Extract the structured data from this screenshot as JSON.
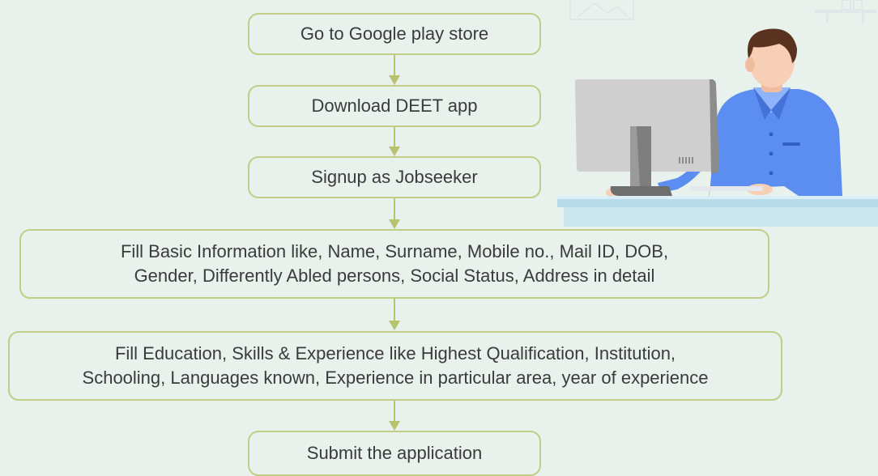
{
  "flowchart": {
    "steps": [
      "Go to Google play store",
      "Download DEET app",
      "Signup as Jobseeker",
      "Fill Basic Information like, Name, Surname, Mobile no., Mail ID, DOB,\nGender, Differently Abled persons, Social Status, Address in detail",
      "Fill Education, Skills & Experience like Highest Qualification, Institution,\nSchooling, Languages known, Experience in particular area, year of experience",
      "Submit the application"
    ]
  },
  "illustration": {
    "icon": "person-at-computer-icon"
  },
  "colors": {
    "background": "#e8f1ec",
    "box_border": "#c2cd86",
    "arrow": "#b6c46e",
    "text": "#3b3b3b",
    "shirt": "#5b8ef0",
    "hair": "#5a3320",
    "skin": "#f7cfb6",
    "desk": "#c9e6f0"
  }
}
